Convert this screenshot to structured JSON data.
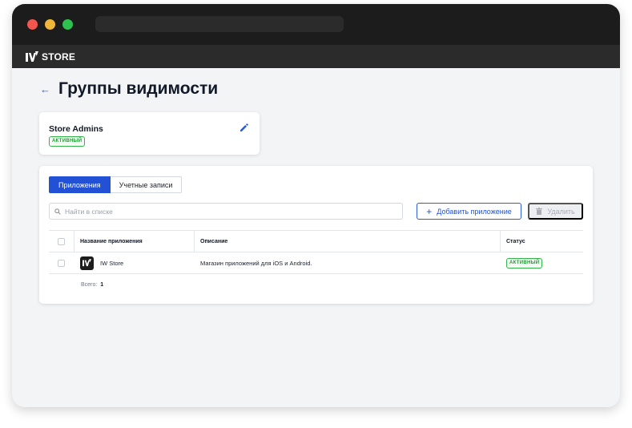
{
  "app": {
    "brand": "STORE"
  },
  "page": {
    "title": "Группы видимости"
  },
  "group": {
    "name": "Store Admins",
    "status": "АКТИВНЫЙ"
  },
  "tabs": [
    {
      "label": "Приложения",
      "active": true
    },
    {
      "label": "Учетные записи",
      "active": false
    }
  ],
  "search": {
    "placeholder": "Найти в списке",
    "value": ""
  },
  "actions": {
    "add_label": "Добавить приложение",
    "delete_label": "Удалить"
  },
  "table": {
    "columns": [
      "Название приложения",
      "Описание",
      "Статус"
    ],
    "rows": [
      {
        "name": "IW Store",
        "description": "Магазин приложений для iOS и Android.",
        "status": "АКТИВНЫЙ"
      }
    ]
  },
  "footer": {
    "total_label": "Всего:",
    "total_value": "1"
  },
  "colors": {
    "accent": "#2351d6",
    "active_badge": "#35b44a",
    "topbar": "#2b2b2b"
  },
  "icons": [
    "back-arrow-icon",
    "edit-pencil-icon",
    "search-icon",
    "plus-icon",
    "trash-icon",
    "iw-logo-icon"
  ]
}
